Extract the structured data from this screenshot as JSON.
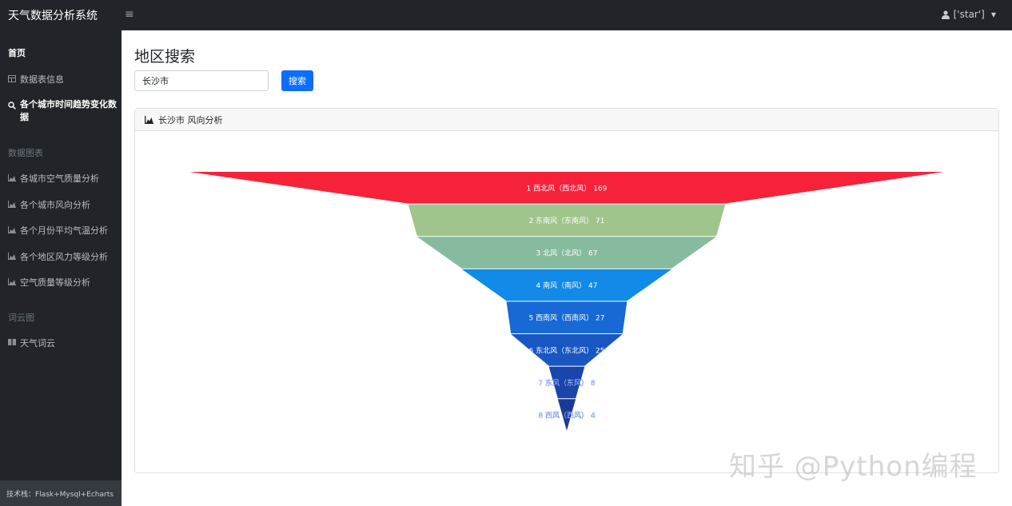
{
  "app": {
    "title": "天气数据分析系统",
    "toggle_icon": "menu-icon"
  },
  "user": {
    "label": "['star']"
  },
  "sidebar": {
    "home": "首页",
    "items_top": [
      {
        "label": "数据表信息",
        "icon": "table-icon"
      },
      {
        "label": "各个城市时间趋势变化数据",
        "icon": "search-icon"
      }
    ],
    "section_charts": "数据图表",
    "chart_items": [
      {
        "label": "各城市空气质量分析",
        "icon": "chart-area-icon"
      },
      {
        "label": "各个城市风向分析",
        "icon": "chart-area-icon"
      },
      {
        "label": "各个月份平均气温分析",
        "icon": "chart-area-icon"
      },
      {
        "label": "各个地区风力等级分析",
        "icon": "chart-area-icon"
      },
      {
        "label": "空气质量等级分析",
        "icon": "chart-area-icon"
      }
    ],
    "section_cloud": "词云图",
    "cloud_items": [
      {
        "label": "天气词云",
        "icon": "book-icon"
      }
    ],
    "footer": "技术栈：Flask+Mysql+Echarts"
  },
  "main": {
    "title": "地区搜索",
    "search_value": "长沙市",
    "search_button": "搜索",
    "card_title": "长沙市 风向分析"
  },
  "chart_data": {
    "type": "funnel",
    "title": "",
    "sort": "descending",
    "items": [
      {
        "label": "1  西北风（西北风）  169",
        "name": "西北风",
        "value": 169,
        "color": "#f5223a"
      },
      {
        "label": "2  东南风（东南风）  71",
        "name": "东南风",
        "value": 71,
        "color": "#9fc58c"
      },
      {
        "label": "3  北风（北风）  67",
        "name": "北风",
        "value": 67,
        "color": "#86bb9f"
      },
      {
        "label": "4  南风（南风）  47",
        "name": "南风",
        "value": 47,
        "color": "#118ae8"
      },
      {
        "label": "5  西南风（西南风）  27",
        "name": "西南风",
        "value": 27,
        "color": "#1769d6"
      },
      {
        "label": "6  东北风（东北风）  25",
        "name": "东北风",
        "value": 25,
        "color": "#1856c2"
      },
      {
        "label": "7  东风（东风）  8",
        "name": "东风",
        "value": 8,
        "color": "#1a45ac"
      },
      {
        "label": "8  西风（西风）  4",
        "name": "西风",
        "value": 4,
        "color": "#1b3a98"
      }
    ]
  },
  "watermark": "知乎 @Python编程"
}
